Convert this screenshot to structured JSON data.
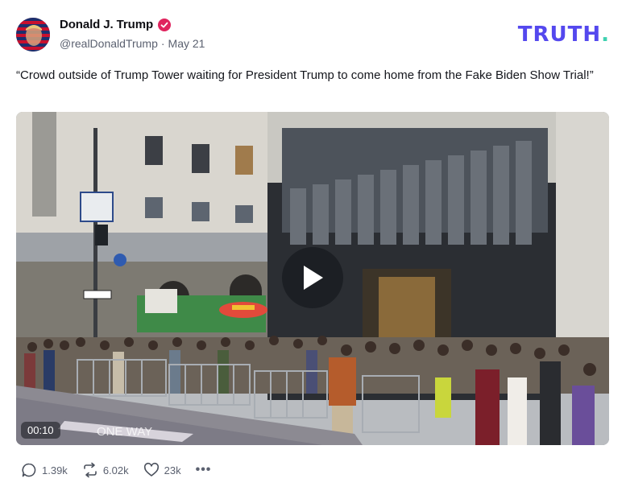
{
  "author": {
    "display_name": "Donald J. Trump",
    "handle": "@realDonaldTrump",
    "separator": "·",
    "date": "May 21",
    "avatar_icon": "avatar-flag-icon",
    "verified_icon": "verified-badge-icon",
    "verified_color": "#e0245e"
  },
  "brand": {
    "logo_text": "TRUTH",
    "logo_dot": ".",
    "logo_color": "#5448ee",
    "dot_color": "#3ed1b0"
  },
  "post": {
    "text": "“Crowd outside of Trump Tower waiting for President Trump to come home from the Fake Biden Show Trial!”"
  },
  "video": {
    "duration": "00:10",
    "play_icon": "play-icon",
    "street_sign": "ONE WAY",
    "arrow_sign": "⇧"
  },
  "actions": {
    "reply_count": "1.39k",
    "retruth_count": "6.02k",
    "like_count": "23k",
    "more_label": "•••",
    "reply_icon": "reply-icon",
    "retruth_icon": "retruth-icon",
    "like_icon": "heart-icon"
  }
}
